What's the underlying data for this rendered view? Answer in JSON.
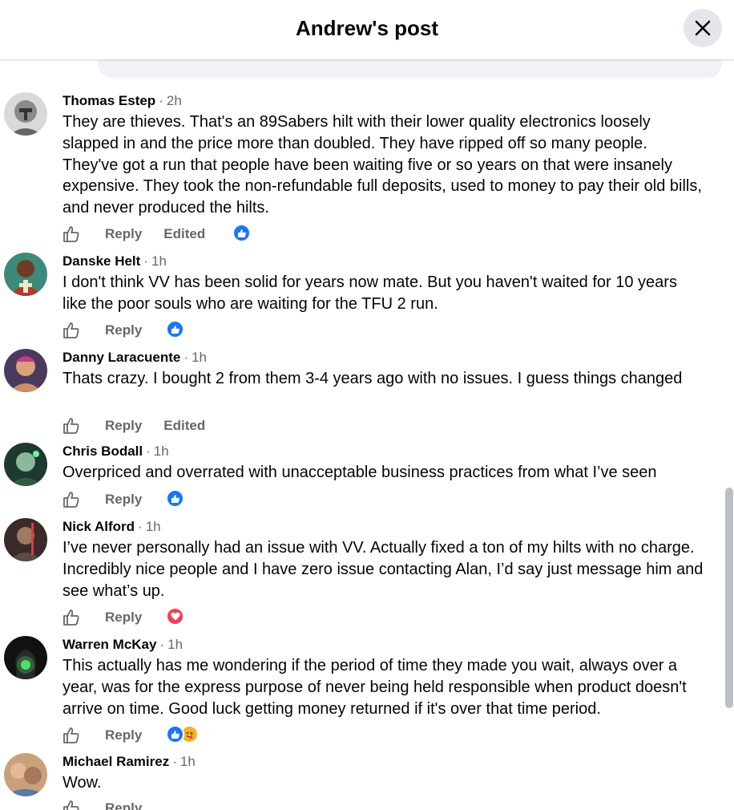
{
  "header": {
    "title": "Andrew's post",
    "close_label": "Close"
  },
  "comments": [
    {
      "author": "Thomas Estep",
      "time": "2h",
      "text": "They are thieves. That's an 89Sabers hilt with their lower quality electronics loosely slapped in and the price more than doubled. They have ripped off so many people. They've got a run that people have been waiting five or so years on that were insanely expensive. They took the non-refundable full deposits, used to money to pay their old bills, and never produced the hilts.",
      "reply": "Reply",
      "edited": "Edited",
      "reactions": [
        "like"
      ]
    },
    {
      "author": "Danske Helt",
      "time": "1h",
      "text": "I don't think VV has been solid for years now mate. But you haven't waited for 10 years like the poor souls who are waiting for the TFU 2 run.",
      "reply": "Reply",
      "reactions": [
        "like"
      ]
    },
    {
      "author": "Danny Laracuente",
      "time": "1h",
      "text": "Thats crazy. I bought 2 from them 3-4 years ago with no issues. I guess things changed",
      "reply": "Reply",
      "edited": "Edited",
      "reactions": []
    },
    {
      "author": "Chris Bodall",
      "time": "1h",
      "text": "Overpriced and overrated with unacceptable business practices from what I’ve seen",
      "reply": "Reply",
      "reactions": [
        "like"
      ]
    },
    {
      "author": "Nick Alford",
      "time": "1h",
      "text": "I’ve never personally had an issue with VV. Actually fixed a ton of my hilts with no charge. Incredibly nice people and I have zero issue contacting Alan, I’d say just message him and see what’s up.",
      "reply": "Reply",
      "reactions": [
        "love"
      ]
    },
    {
      "author": "Warren McKay",
      "time": "1h",
      "text": "This actually has me wondering if the period of time they made you wait, always over a year, was for the express purpose of never being held responsible when product doesn't arrive on time. Good luck getting money returned if it's over that time period.",
      "reply": "Reply",
      "reactions": [
        "like",
        "haha-tongue"
      ]
    },
    {
      "author": "Michael Ramirez",
      "time": "1h",
      "text": "Wow.",
      "reply": "Reply",
      "reactions": []
    }
  ],
  "colors": {
    "like": "#1877f2",
    "love": "#f33e58",
    "muted": "#65676b",
    "haha": "#f7b125"
  }
}
